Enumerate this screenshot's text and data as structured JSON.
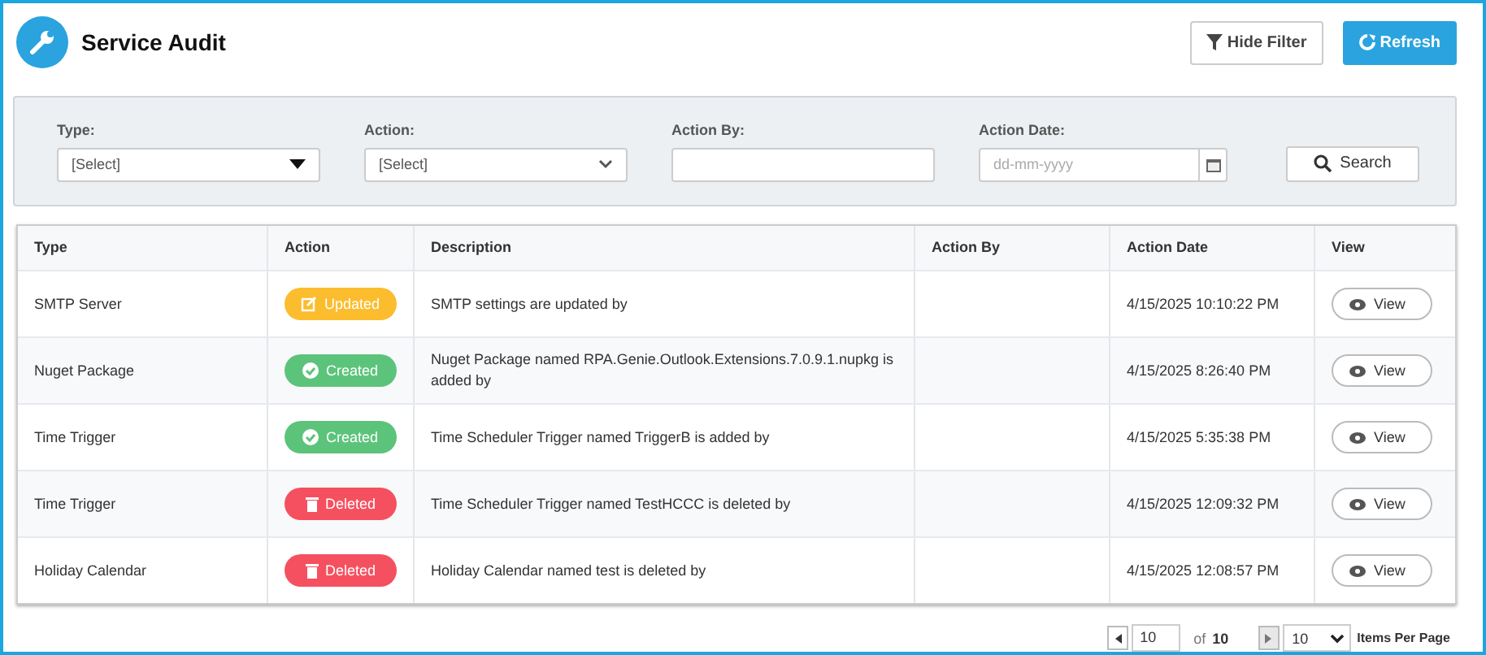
{
  "header": {
    "title": "Service Audit",
    "buttons": [
      {
        "kind": "filter",
        "label": "Hide Filter"
      },
      {
        "kind": "refresh",
        "label": "Refresh"
      }
    ]
  },
  "filters": [
    {
      "kind": "dropdown",
      "label": "Type:",
      "value": "[Select]"
    },
    {
      "kind": "select",
      "label": "Action:",
      "value": "[Select]"
    },
    {
      "kind": "text",
      "label": "Action By:"
    },
    {
      "kind": "date",
      "label": "Action Date:",
      "placeholder": "dd-mm-yyyy"
    }
  ],
  "search_button": "Search",
  "table": {
    "columns": [
      "Type",
      "Action",
      "Description",
      "Action By",
      "Action Date",
      "View"
    ],
    "rows": [
      {
        "type": "SMTP Server",
        "action": {
          "kind": "updated",
          "label": "Updated"
        },
        "description": "SMTP settings are updated by",
        "date": "4/15/2025 10:10:22 PM",
        "view": "View"
      },
      {
        "type": "Nuget Package",
        "action": {
          "kind": "created",
          "label": "Created"
        },
        "description": "Nuget Package named RPA.Genie.Outlook.Extensions.7.0.9.1.nupkg is added by",
        "date": "4/15/2025 8:26:40 PM",
        "view": "View"
      },
      {
        "type": "Time Trigger",
        "action": {
          "kind": "created",
          "label": "Created"
        },
        "description": "Time Scheduler Trigger named TriggerB is added by",
        "date": "4/15/2025 5:35:38 PM",
        "view": "View"
      },
      {
        "type": "Time Trigger",
        "action": {
          "kind": "deleted",
          "label": "Deleted"
        },
        "description": "Time Scheduler Trigger named TestHCCC is deleted by",
        "date": "4/15/2025 12:09:32 PM",
        "view": "View"
      },
      {
        "type": "Holiday Calendar",
        "action": {
          "kind": "deleted",
          "label": "Deleted"
        },
        "description": "Holiday Calendar named test is deleted by",
        "date": "4/15/2025 12:08:57 PM",
        "view": "View"
      }
    ]
  },
  "pagination": {
    "prev_disabled": false,
    "page": "10",
    "of_label": "of",
    "total": "10",
    "next_disabled": true,
    "page_size": "10",
    "page_size_label": "Items Per Page"
  }
}
